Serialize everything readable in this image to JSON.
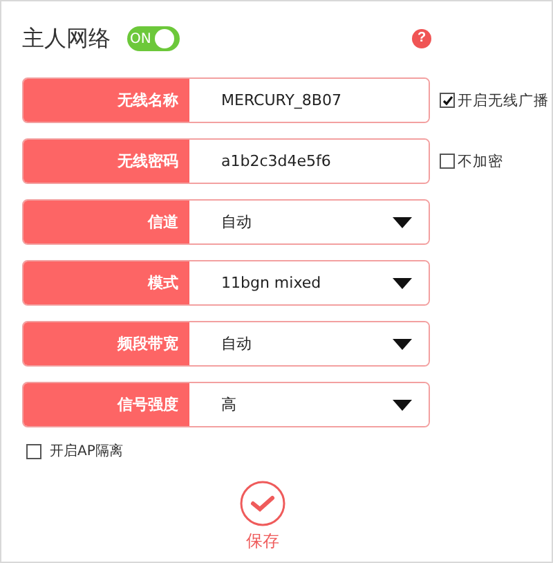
{
  "header": {
    "title": "主人网络",
    "switch": {
      "label": "ON",
      "on": true
    },
    "help": "?"
  },
  "fields": [
    {
      "kind": "text",
      "label": "无线名称",
      "value": "MERCURY_8B07",
      "option": {
        "label": "开启无线广播",
        "checked": true
      }
    },
    {
      "kind": "text",
      "label": "无线密码",
      "value": "a1b2c3d4e5f6",
      "option": {
        "label": "不加密",
        "checked": false
      }
    },
    {
      "kind": "select",
      "label": "信道",
      "value": "自动"
    },
    {
      "kind": "select",
      "label": "模式",
      "value": "11bgn mixed"
    },
    {
      "kind": "select",
      "label": "频段带宽",
      "value": "自动"
    },
    {
      "kind": "select",
      "label": "信号强度",
      "value": "高"
    }
  ],
  "ap_isolation": {
    "label": "开启AP隔离",
    "checked": false
  },
  "save_button": {
    "label": "保存"
  }
}
